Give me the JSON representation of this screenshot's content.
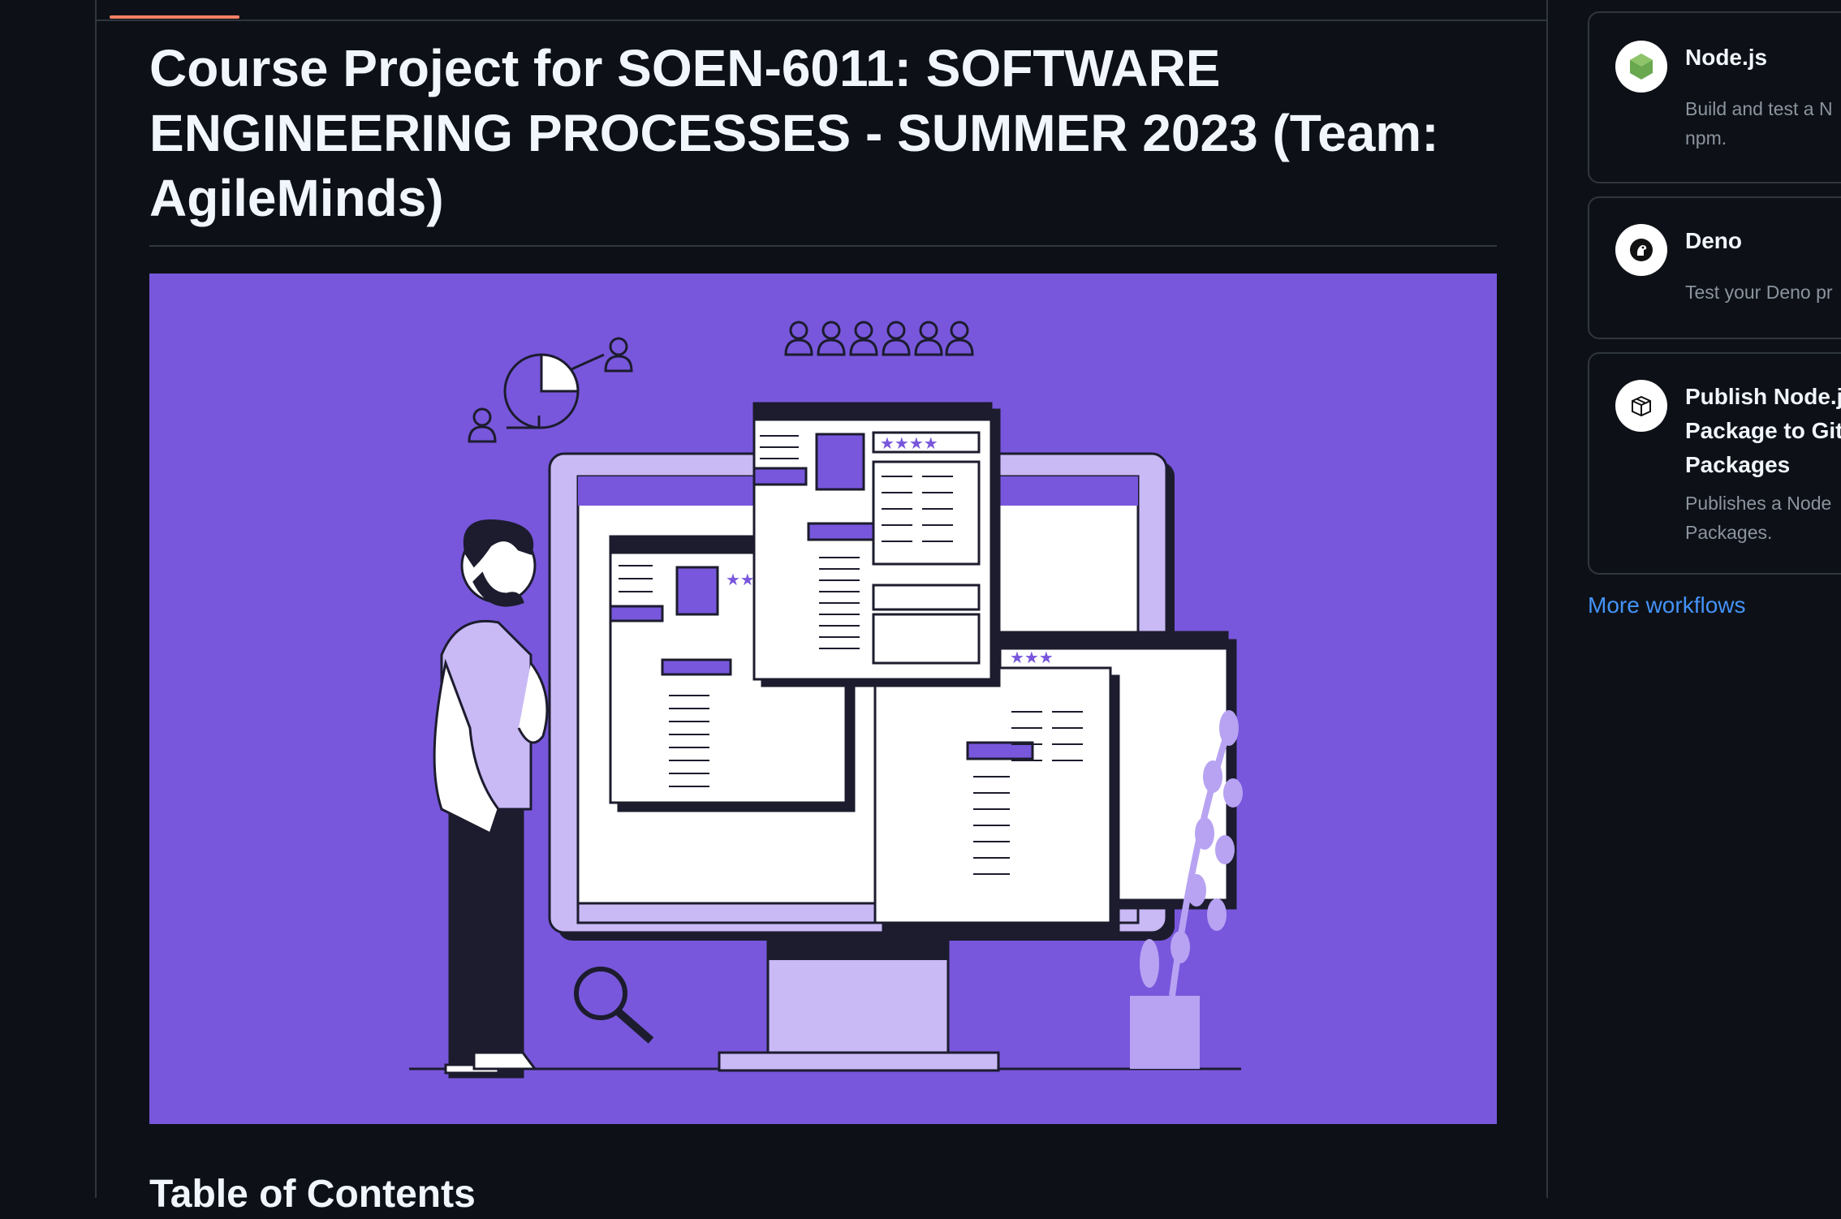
{
  "readme": {
    "title": "Course Project for SOEN-6011: SOFTWARE ENGINEERING PROCESSES - SUMMER 2023 (Team: AgileMinds)",
    "toc_heading": "Table of Contents",
    "banner_color": "#7857dc"
  },
  "sidebar": {
    "workflows": [
      {
        "title": "Node.js",
        "description_lines": [
          "Build and test a N",
          "npm."
        ],
        "icon": "nodejs-icon"
      },
      {
        "title": "Deno",
        "description_lines": [
          "Test your Deno pr"
        ],
        "icon": "deno-icon"
      },
      {
        "title_lines": [
          "Publish Node.js",
          "Package to Git",
          "Packages"
        ],
        "description_lines": [
          "Publishes a Node",
          "Packages."
        ],
        "icon": "package-icon"
      }
    ],
    "more_link": "More workflows"
  },
  "colors": {
    "background": "#0d1117",
    "border": "#30363d",
    "accent_tab": "#f78166",
    "link": "#4493f8",
    "muted_text": "#8b949e"
  }
}
